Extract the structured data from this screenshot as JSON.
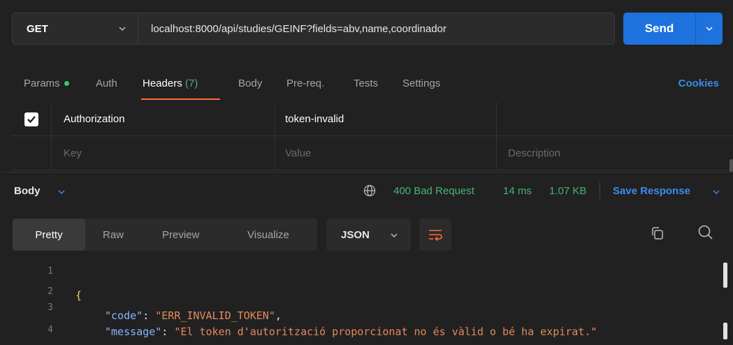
{
  "request": {
    "method": "GET",
    "url": "localhost:8000/api/studies/GEINF?fields=abv,name,coordinador",
    "send_label": "Send"
  },
  "tabs": [
    {
      "label": "Params"
    },
    {
      "label": "Auth"
    },
    {
      "label": "Headers",
      "count": "(7)"
    },
    {
      "label": "Body"
    },
    {
      "label": "Pre-req."
    },
    {
      "label": "Tests"
    },
    {
      "label": "Settings"
    }
  ],
  "cookies_label": "Cookies",
  "headers_table": {
    "rows": [
      {
        "checked": true,
        "key": "Authorization",
        "value": "token-invalid",
        "description": ""
      }
    ],
    "placeholder": {
      "key": "Key",
      "value": "Value",
      "description": "Description"
    }
  },
  "response": {
    "body_label": "Body",
    "status": "400 Bad Request",
    "time": "14 ms",
    "size": "1.07 KB",
    "save_label": "Save Response",
    "views": [
      "Pretty",
      "Raw",
      "Preview",
      "Visualize"
    ],
    "active_view": "Pretty",
    "format": "JSON",
    "lines": [
      {
        "num": "1",
        "open": "{"
      },
      {
        "num": "2",
        "key": "\"code\"",
        "value": "\"ERR_INVALID_TOKEN\"",
        "trail": ","
      },
      {
        "num": "3",
        "key": "\"message\"",
        "value": "\"El token d'autorització proporcionat no és vàlid o bé ha expirat.\"",
        "trail": ""
      },
      {
        "num": "4",
        "close": "}"
      }
    ]
  },
  "colors": {
    "accent": "#1e72dd",
    "success": "#44b574",
    "active_tab_underline": "#ff6c37",
    "link": "#3d8be8"
  }
}
